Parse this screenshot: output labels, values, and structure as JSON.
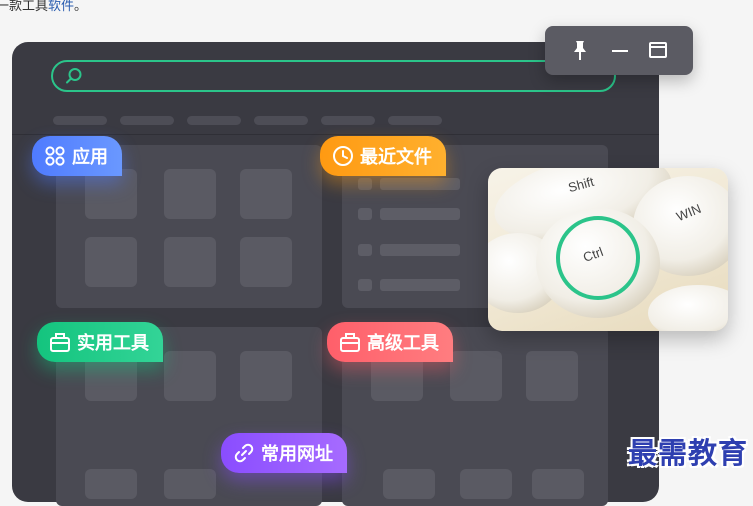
{
  "header": {
    "text_prefix": "一款工具",
    "text_link": "软件",
    "text_suffix": "。"
  },
  "tags": {
    "apps": "应用",
    "recent_files": "最近文件",
    "practical_tools": "实用工具",
    "advanced_tools": "高级工具",
    "common_sites": "常用网址"
  },
  "keyboard": {
    "key_shift": "Shift",
    "key_ctrl": "Ctrl",
    "key_win": "WIN"
  },
  "watermark": "最需教育",
  "colors": {
    "accent_green": "#2bc48a",
    "apps_blue": "#4f7bff",
    "recent_orange": "#ff9a12",
    "tools_green": "#14c47e",
    "advanced_red": "#ff5f6a",
    "sites_purple": "#8a4dff",
    "panel_bg": "#3a3a42"
  },
  "icons": {
    "search": "search-icon",
    "pin": "pin-icon",
    "minimize": "minimize-icon",
    "maximize": "maximize-icon",
    "apps": "apps-grid-icon",
    "recent": "clock-icon",
    "tools": "toolbox-icon",
    "advanced": "toolbox-icon",
    "sites": "link-icon"
  }
}
